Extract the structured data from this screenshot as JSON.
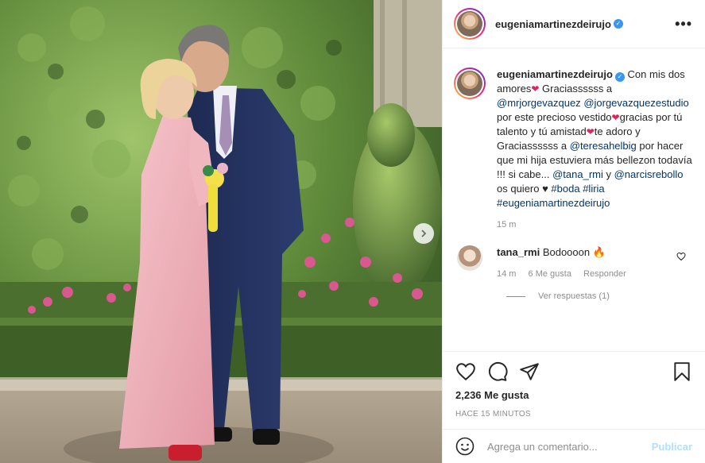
{
  "post": {
    "username": "eugeniamartinezdeirujo",
    "verified_mark": "✓",
    "more_icon": "more-horizontal-icon",
    "caption": {
      "username": "eugeniamartinezdeirujo",
      "parts": [
        {
          "t": "text",
          "v": " Con mis dos amores"
        },
        {
          "t": "heart",
          "v": "❤"
        },
        {
          "t": "text",
          "v": " Graciassssss a "
        },
        {
          "t": "tag",
          "v": "@mrjorgevazquez"
        },
        {
          "t": "text",
          "v": " "
        },
        {
          "t": "tag",
          "v": "@jorgevazquezestudio"
        },
        {
          "t": "text",
          "v": " por este precioso vestido"
        },
        {
          "t": "heart",
          "v": "❤"
        },
        {
          "t": "text",
          "v": "gracias por tú talento y tú amistad"
        },
        {
          "t": "heart",
          "v": "❤"
        },
        {
          "t": "text",
          "v": "te adoro y Graciassssss a "
        },
        {
          "t": "tag",
          "v": "@teresahelbig"
        },
        {
          "t": "text",
          "v": " por hacer que mi hija estuviera más bellezon todavía !!! si cabe... "
        },
        {
          "t": "tag",
          "v": "@tana_rmi"
        },
        {
          "t": "text",
          "v": " y "
        },
        {
          "t": "tag",
          "v": "@narcisrebollo"
        },
        {
          "t": "text",
          "v": " os quiero ♥ "
        },
        {
          "t": "tag",
          "v": "#boda"
        },
        {
          "t": "text",
          "v": " "
        },
        {
          "t": "tag",
          "v": "#liria"
        },
        {
          "t": "text",
          "v": " "
        },
        {
          "t": "tag",
          "v": "#eugeniamartinezdeirujo"
        }
      ],
      "time": "15 m"
    },
    "comment": {
      "username": "tana_rmi",
      "text": " Bodoooon 🔥",
      "time": "14 m",
      "likes": "6 Me gusta",
      "reply": "Responder",
      "view_replies": "Ver respuestas (1)"
    },
    "likes": "2,236 Me gusta",
    "posted_ago": "HACE 15 MINUTOS",
    "comment_placeholder": "Agrega un comentario...",
    "publish_label": "Publicar"
  },
  "colors": {
    "link": "#00376b",
    "verified": "#3897f0",
    "publish_disabled": "#b2dffc"
  }
}
